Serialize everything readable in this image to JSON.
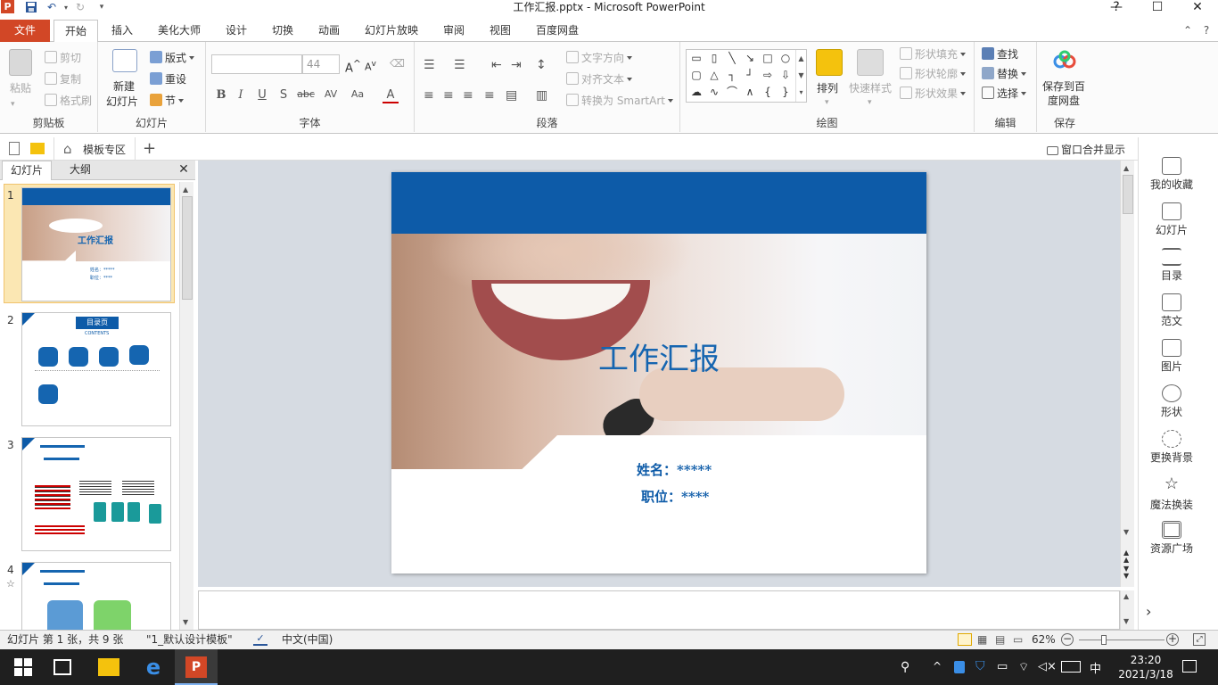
{
  "window": {
    "title": "工作汇报.pptx - Microsoft PowerPoint",
    "app_logo": "P",
    "controls": {
      "minimize": "—",
      "maximize": "☐",
      "close": "✕"
    }
  },
  "quick_access": {
    "save_icon": "save-icon",
    "undo_icon": "undo-icon",
    "redo_icon": "redo-icon"
  },
  "ribbon_tabs": [
    "文件",
    "开始",
    "插入",
    "美化大师",
    "设计",
    "切换",
    "动画",
    "幻灯片放映",
    "审阅",
    "视图",
    "百度网盘"
  ],
  "active_tab": "开始",
  "ribbon": {
    "clipboard": {
      "label": "剪贴板",
      "paste": "粘贴",
      "cut": "剪切",
      "copy": "复制",
      "format_painter": "格式刷"
    },
    "slides": {
      "label": "幻灯片",
      "new_slide_1": "新建",
      "new_slide_2": "幻灯片",
      "layout": "版式",
      "reset": "重设",
      "section": "节"
    },
    "font": {
      "label": "字体",
      "font_name": "",
      "font_size": "44",
      "bold": "B",
      "italic": "I",
      "underline": "U",
      "shadow": "S",
      "strike": "abc",
      "spacing": "AV",
      "case": "Aa",
      "color": "A"
    },
    "paragraph": {
      "label": "段落",
      "text_direction": "文字方向",
      "align_text": "对齐文本",
      "smartart": "转换为 SmartArt"
    },
    "drawing": {
      "label": "绘图",
      "arrange": "排列",
      "quick_styles": "快速样式",
      "shape_fill": "形状填充",
      "shape_outline": "形状轮廓",
      "shape_effects": "形状效果"
    },
    "editing": {
      "label": "编辑",
      "find": "查找",
      "replace": "替换",
      "select": "选择"
    },
    "save": {
      "label": "保存",
      "save_baidu_1": "保存到百",
      "save_baidu_2": "度网盘"
    }
  },
  "doc_tabs": {
    "template_zone": "模板专区",
    "add": "+",
    "merge_windows": "窗口合并显示"
  },
  "panel_tabs": {
    "slides": "幻灯片",
    "outline": "大纲",
    "close": "✕"
  },
  "thumbnails": [
    {
      "num": "1",
      "title": "工作汇报",
      "line1": "姓名：*****",
      "line2": "职位：****"
    },
    {
      "num": "2",
      "title": "目录页",
      "subtitle": "CONTENTS"
    },
    {
      "num": "3"
    },
    {
      "num": "4",
      "star": "☆"
    }
  ],
  "slide": {
    "title": "工作汇报",
    "name_label": "姓名：*****",
    "position_label": "职位：****",
    "header_color": "#0d5ba8",
    "title_color": "#1565b0"
  },
  "right_panel": [
    "我的收藏",
    "幻灯片",
    "目录",
    "范文",
    "图片",
    "形状",
    "更换背景",
    "魔法换装",
    "资源广场"
  ],
  "status": {
    "slide_info": "幻灯片 第 1 张，共 9 张",
    "theme": "\"1_默认设计模板\"",
    "language": "中文(中国)",
    "zoom": "62%",
    "zoom_level_percent": 62
  },
  "taskbar": {
    "time": "23:20",
    "date": "2021/3/18",
    "ime": "中"
  }
}
